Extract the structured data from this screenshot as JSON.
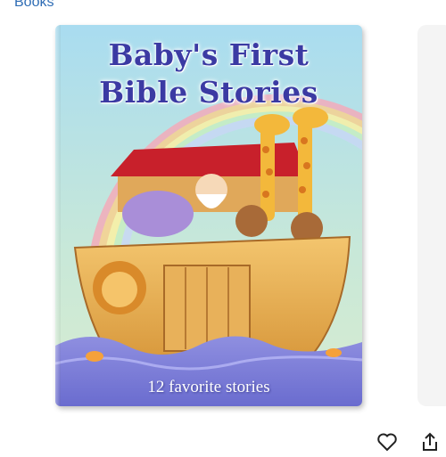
{
  "breadcrumb": {
    "category_label": "Books"
  },
  "product": {
    "cover_title_line1": "Baby's First",
    "cover_title_line2": "Bible Stories",
    "cover_subtitle": "12 favorite stories"
  },
  "actions": [
    {
      "icon": "heart-icon"
    },
    {
      "icon": "share-icon"
    }
  ],
  "colors": {
    "link": "#2f6db5",
    "title": "#3b3aa3"
  }
}
